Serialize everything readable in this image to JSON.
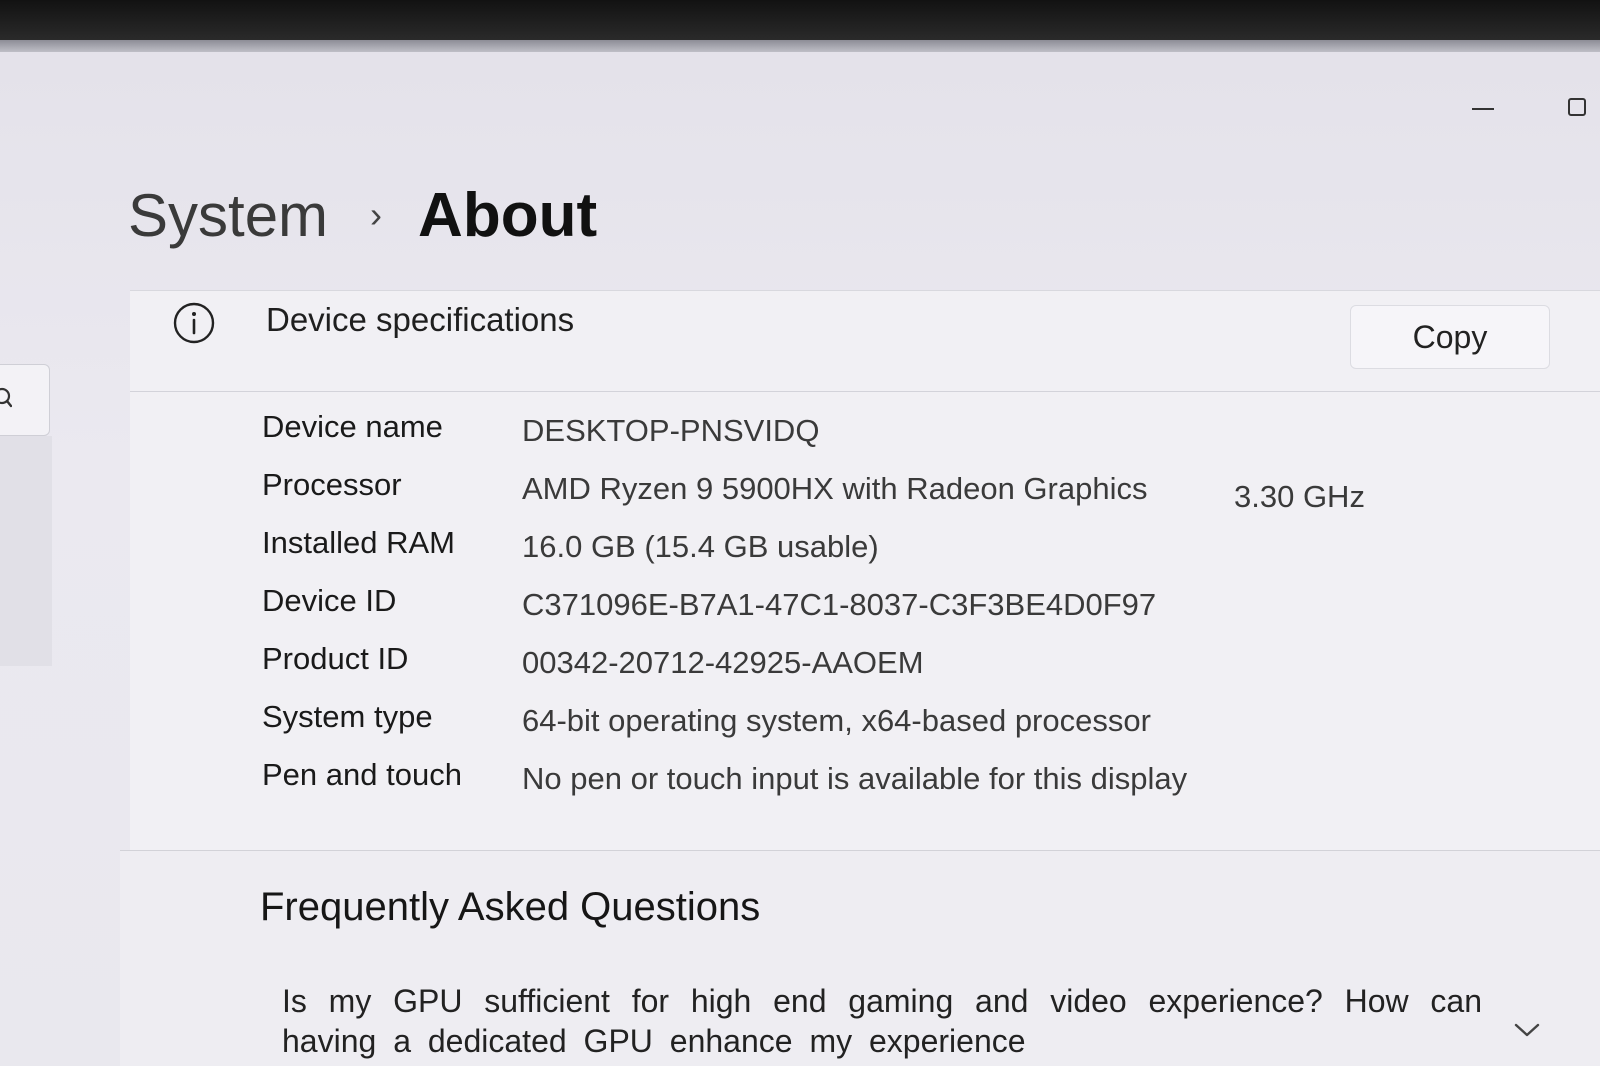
{
  "breadcrumb": {
    "parent": "System",
    "separator": "›",
    "current": "About"
  },
  "specs": {
    "title": "Device specifications",
    "copy_label": "Copy",
    "rows": [
      {
        "label": "Device name",
        "value": "DESKTOP-PNSVIDQ"
      },
      {
        "label": "Processor",
        "value": "AMD Ryzen 9 5900HX with Radeon Graphics",
        "extra": "3.30 GHz"
      },
      {
        "label": "Installed RAM",
        "value": "16.0 GB (15.4 GB usable)"
      },
      {
        "label": "Device ID",
        "value": "C371096E-B7A1-47C1-8037-C3F3BE4D0F97"
      },
      {
        "label": "Product ID",
        "value": "00342-20712-42925-AAOEM"
      },
      {
        "label": "System type",
        "value": "64-bit operating system, x64-based processor"
      },
      {
        "label": "Pen and touch",
        "value": "No pen or touch input is available for this display"
      }
    ]
  },
  "faq": {
    "heading": "Frequently Asked Questions",
    "question": "Is my GPU sufficient for high end gaming and video experience? How can having a dedicated GPU enhance my experience"
  },
  "icons": {
    "info": "info-icon",
    "search": "search-icon",
    "expand": "chevron-down-icon",
    "minimize": "minimize-icon",
    "maximize": "maximize-icon"
  }
}
